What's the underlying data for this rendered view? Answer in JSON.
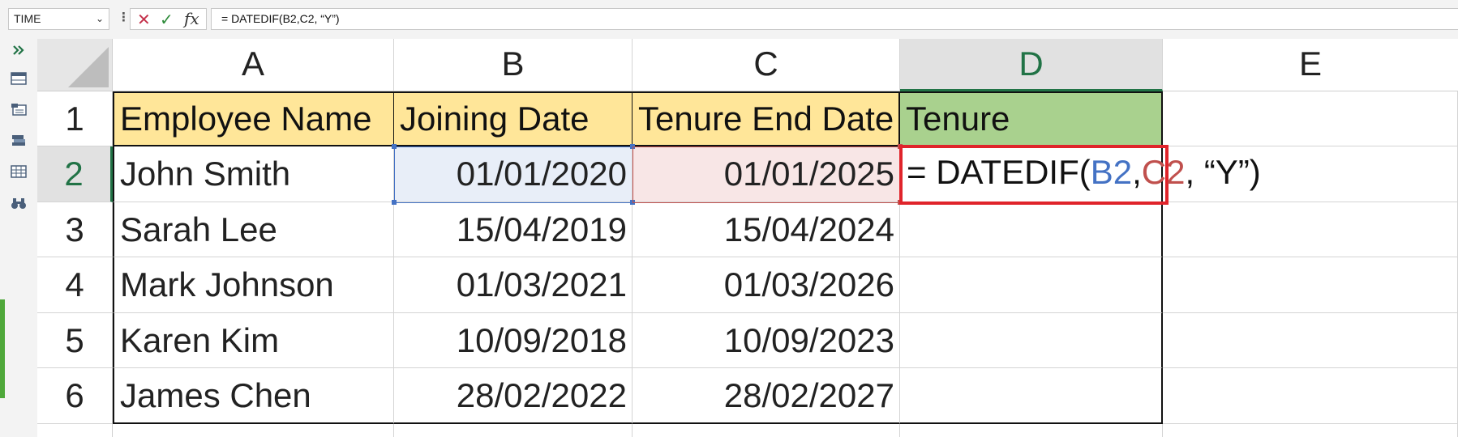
{
  "formula_bar": {
    "name_box": "TIME",
    "formula": "=  DATEDIF(B2,C2, “Y”)",
    "cancel_glyph": "✕",
    "enter_glyph": "✓",
    "fx_label": "fx"
  },
  "columns": [
    "A",
    "B",
    "C",
    "D",
    "E"
  ],
  "rows": [
    "1",
    "2",
    "3",
    "4",
    "5",
    "6"
  ],
  "table": {
    "headers": [
      "Employee Name",
      "Joining Date",
      "Tenure End Date",
      "Tenure"
    ],
    "data": [
      [
        "John Smith",
        "01/01/2020",
        "01/01/2025"
      ],
      [
        "Sarah Lee",
        "15/04/2019",
        "15/04/2024"
      ],
      [
        "Mark Johnson",
        "01/03/2021",
        "01/03/2026"
      ],
      [
        "Karen Kim",
        "10/09/2018",
        "10/09/2023"
      ],
      [
        "James Chen",
        "28/02/2022",
        "28/02/2027"
      ]
    ]
  },
  "editing_cell": {
    "ref": "D2",
    "prefix": "=  DATEDIF(",
    "ref1": "B2",
    "sep": ",",
    "ref2": "C2",
    "suffix": ", “Y”)"
  },
  "colors": {
    "header_yellow": "#ffe699",
    "header_green": "#a9d18e",
    "active_header_green": "#217346",
    "ref_blue": "#4472c4",
    "ref_red": "#c0504d",
    "highlight_box": "#e0242b"
  },
  "icons": [
    "expand-chevrons-icon",
    "table-icon",
    "form-icon",
    "stack-icon",
    "grid-icon",
    "binoculars-icon"
  ]
}
